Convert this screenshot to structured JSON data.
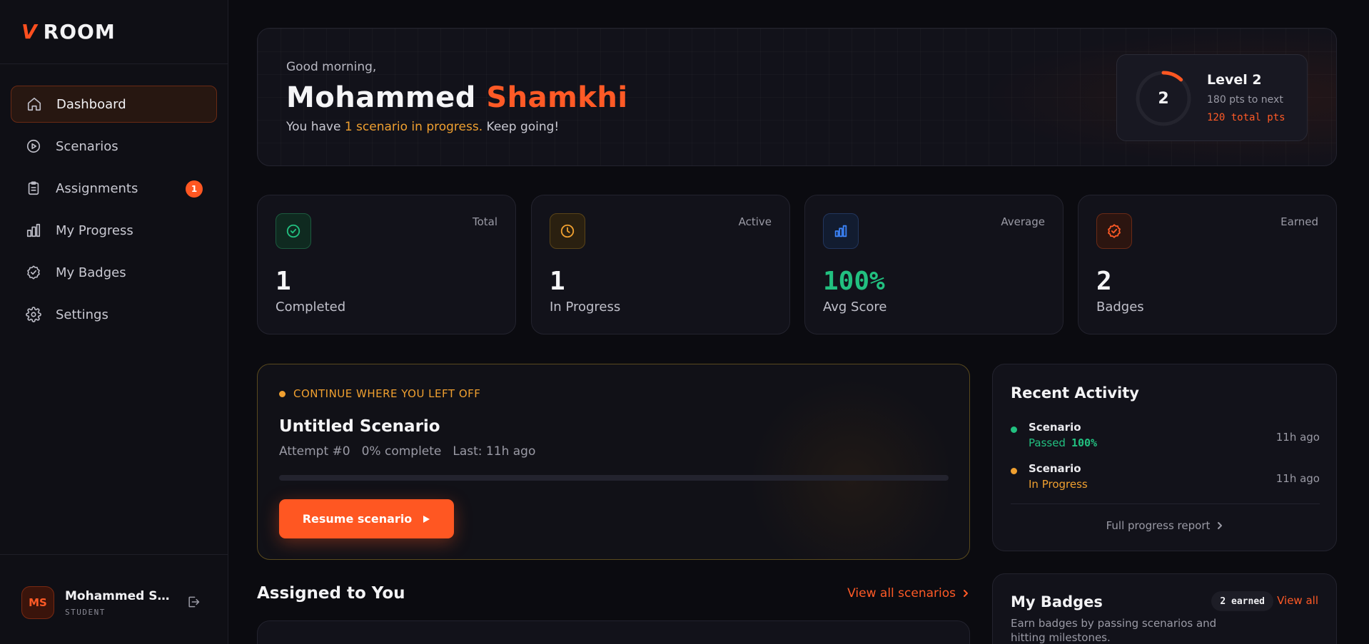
{
  "brand": {
    "mark": "V",
    "name": "ROOM"
  },
  "sidebar": {
    "items": [
      {
        "label": "Dashboard",
        "icon": "home-icon",
        "active": true
      },
      {
        "label": "Scenarios",
        "icon": "play-circle-icon"
      },
      {
        "label": "Assignments",
        "icon": "clipboard-icon",
        "badge": "1"
      },
      {
        "label": "My Progress",
        "icon": "bar-chart-icon"
      },
      {
        "label": "My Badges",
        "icon": "badge-check-icon"
      },
      {
        "label": "Settings",
        "icon": "gear-icon"
      }
    ],
    "user": {
      "initials": "MS",
      "name": "Mohammed Sh...",
      "role": "STUDENT"
    }
  },
  "hero": {
    "greeting": "Good morning,",
    "first_name": "Mohammed",
    "last_name": "Shamkhi",
    "sub_prefix": "You have ",
    "sub_highlight": "1 scenario in progress.",
    "sub_suffix": " Keep going!",
    "level": {
      "number": "2",
      "title": "Level 2",
      "next": "180 pts to next",
      "total": "120 total pts",
      "progress": 0.12
    }
  },
  "stats": [
    {
      "tag": "Total",
      "value": "1",
      "label": "Completed",
      "icon": "check-circle-icon",
      "color": "#22c080"
    },
    {
      "tag": "Active",
      "value": "1",
      "label": "In Progress",
      "icon": "clock-icon",
      "color": "#f0a030"
    },
    {
      "tag": "Average",
      "value": "100%",
      "label": "Avg Score",
      "icon": "bar-chart-icon",
      "color": "#3b82f6"
    },
    {
      "tag": "Earned",
      "value": "2",
      "label": "Badges",
      "icon": "badge-check-icon",
      "color": "#ff5a26"
    }
  ],
  "continue": {
    "tag": "CONTINUE WHERE YOU LEFT OFF",
    "title": "Untitled Scenario",
    "attempt": "Attempt #0",
    "complete": "0% complete",
    "last": "Last: 11h ago",
    "progress": 0,
    "button": "Resume scenario"
  },
  "assigned": {
    "title": "Assigned to You",
    "view_all": "View all scenarios"
  },
  "recent": {
    "title": "Recent Activity",
    "items": [
      {
        "name": "Scenario",
        "status": "Passed",
        "score": "100%",
        "time": "11h ago",
        "color": "#22c080"
      },
      {
        "name": "Scenario",
        "status": "In Progress",
        "time": "11h ago",
        "color": "#f0a030"
      }
    ],
    "report": "Full progress report"
  },
  "badges": {
    "title": "My Badges",
    "desc": "Earn badges by passing scenarios and hitting milestones.",
    "earned": "2 earned",
    "view_all": "View all"
  },
  "colors": {
    "accent": "#ff5722",
    "warning": "#f0a030",
    "success": "#22c080",
    "info": "#3b82f6"
  }
}
